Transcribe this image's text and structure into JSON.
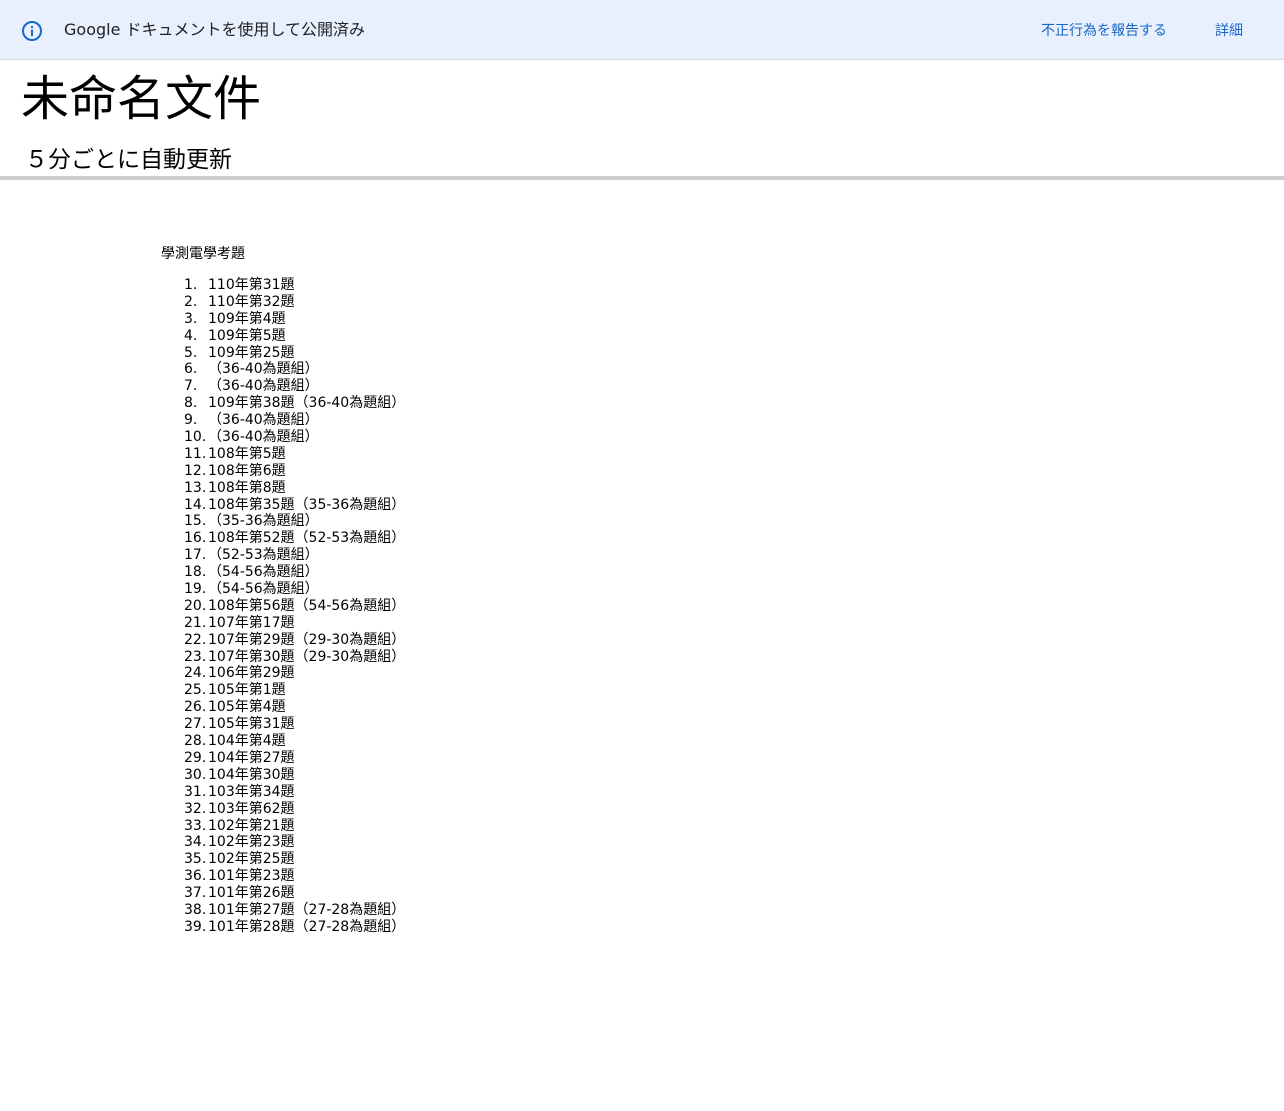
{
  "banner": {
    "icon": "info-icon",
    "published_text": "Google ドキュメントを使用して公開済み",
    "report_link": "不正行為を報告する",
    "details_link": "詳細",
    "background_color": "#e8f0fe",
    "link_color": "#1a66c8"
  },
  "document": {
    "title": "未命名文件",
    "subtitle": "５分ごとに自動更新",
    "heading": "學測電學考題",
    "items": [
      {
        "num": "1.",
        "text": "110年第31題"
      },
      {
        "num": "2.",
        "text": "110年第32題"
      },
      {
        "num": "3.",
        "text": "109年第4題"
      },
      {
        "num": "4.",
        "text": "109年第5題"
      },
      {
        "num": "5.",
        "text": "109年第25題"
      },
      {
        "num": "6.",
        "text": "（36-40為題組）"
      },
      {
        "num": "7.",
        "text": "（36-40為題組）"
      },
      {
        "num": "8.",
        "text": "109年第38題（36-40為題組）"
      },
      {
        "num": "9.",
        "text": "（36-40為題組）"
      },
      {
        "num": "10.",
        "text": "（36-40為題組）"
      },
      {
        "num": "11.",
        "text": "108年第5題"
      },
      {
        "num": "12.",
        "text": "108年第6題"
      },
      {
        "num": "13.",
        "text": "108年第8題"
      },
      {
        "num": "14.",
        "text": "108年第35題（35-36為題組）"
      },
      {
        "num": "15.",
        "text": "（35-36為題組）"
      },
      {
        "num": "16.",
        "text": "108年第52題（52-53為題組）"
      },
      {
        "num": "17.",
        "text": "（52-53為題組）"
      },
      {
        "num": "18.",
        "text": "（54-56為題組）"
      },
      {
        "num": "19.",
        "text": "（54-56為題組）"
      },
      {
        "num": "20.",
        "text": "108年第56題（54-56為題組）"
      },
      {
        "num": "21.",
        "text": "107年第17題"
      },
      {
        "num": "22.",
        "text": "107年第29題（29-30為題組）"
      },
      {
        "num": "23.",
        "text": "107年第30題（29-30為題組）"
      },
      {
        "num": "24.",
        "text": "106年第29題"
      },
      {
        "num": "25.",
        "text": "105年第1題"
      },
      {
        "num": "26.",
        "text": "105年第4題"
      },
      {
        "num": "27.",
        "text": "105年第31題"
      },
      {
        "num": "28.",
        "text": "104年第4題"
      },
      {
        "num": "29.",
        "text": "104年第27題"
      },
      {
        "num": "30.",
        "text": "104年第30題"
      },
      {
        "num": "31.",
        "text": "103年第34題"
      },
      {
        "num": "32.",
        "text": "103年第62題"
      },
      {
        "num": "33.",
        "text": "102年第21題"
      },
      {
        "num": "34.",
        "text": "102年第23題"
      },
      {
        "num": "35.",
        "text": "102年第25題"
      },
      {
        "num": "36.",
        "text": "101年第23題"
      },
      {
        "num": "37.",
        "text": "101年第26題"
      },
      {
        "num": "38.",
        "text": "101年第27題（27-28為題組）"
      },
      {
        "num": "39.",
        "text": "101年第28題（27-28為題組）"
      }
    ]
  }
}
